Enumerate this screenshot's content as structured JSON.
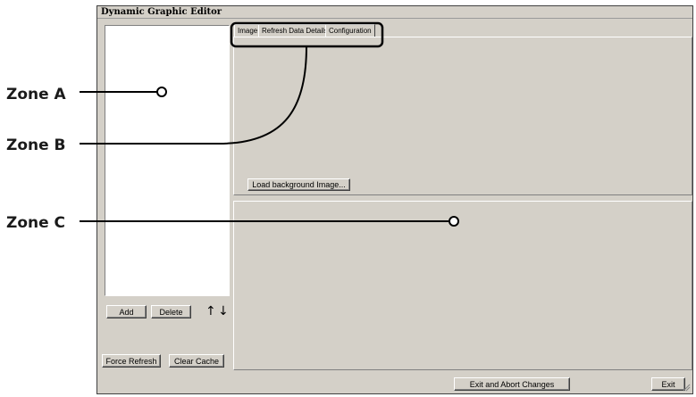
{
  "window": {
    "title": "Dynamic Graphic Editor"
  },
  "tabs": [
    {
      "label": "Image"
    },
    {
      "label": "Refresh Data Details"
    },
    {
      "label": "Configuration"
    }
  ],
  "left_panel": {
    "add_label": "Add",
    "delete_label": "Delete",
    "move_up_glyph": "↑",
    "move_down_glyph": "↓",
    "force_refresh_label": "Force Refresh",
    "clear_cache_label": "Clear Cache"
  },
  "image_tab": {
    "load_background_label": "Load background Image..."
  },
  "footer": {
    "exit_abort_label": "Exit and Abort Changes",
    "exit_label": "Exit"
  },
  "annotations": {
    "zone_a": "Zone A",
    "zone_b": "Zone B",
    "zone_c": "Zone C"
  }
}
